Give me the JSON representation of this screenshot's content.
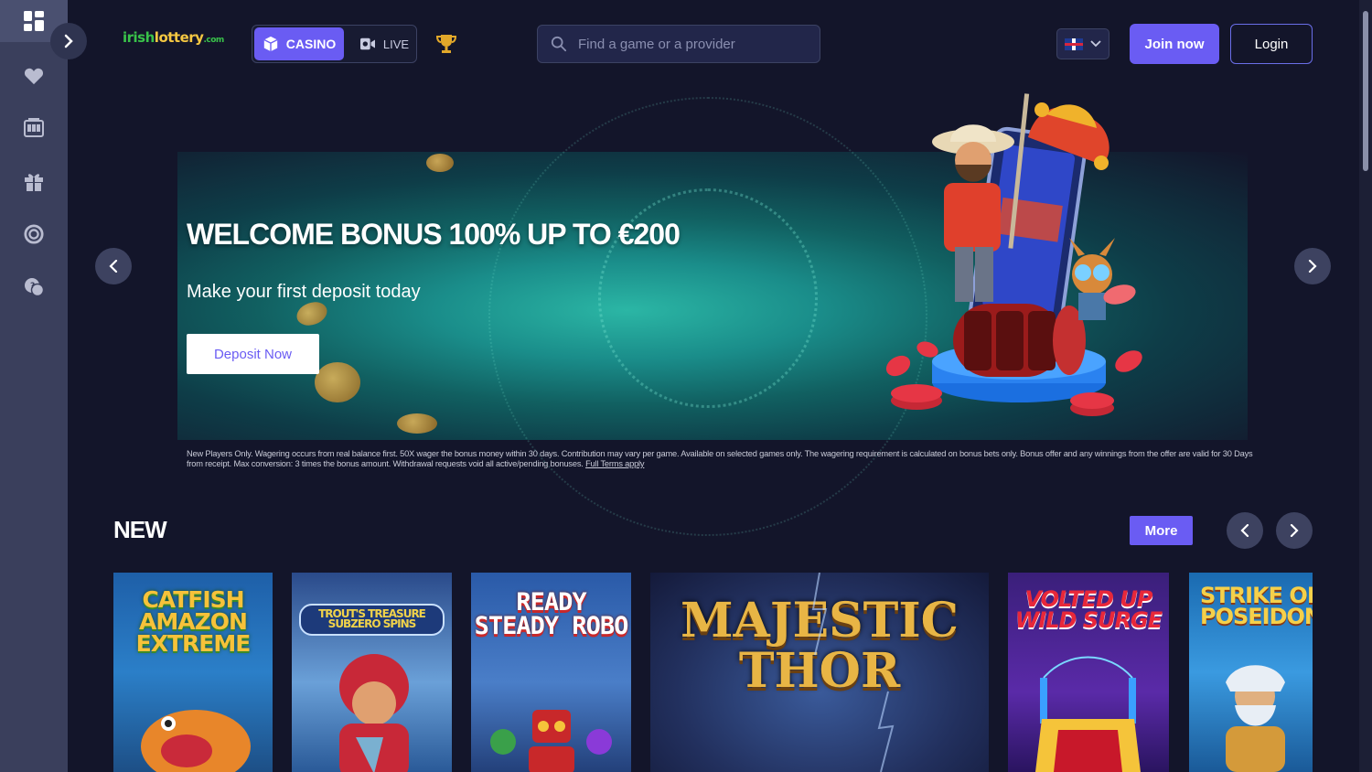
{
  "header": {
    "logo_text_green": "irish",
    "logo_text_gold": "lottery",
    "logo_suffix": ".com",
    "tabs": [
      {
        "label": "CASINO",
        "icon": "cube-icon",
        "active": true
      },
      {
        "label": "LIVE",
        "icon": "live-camera-icon",
        "active": false
      }
    ],
    "search": {
      "placeholder": "Find a game or a provider"
    },
    "language": "English (UK)",
    "join_label": "Join now",
    "login_label": "Login"
  },
  "sidebar": {
    "items": [
      {
        "name": "dashboard",
        "icon": "grid-icon"
      },
      {
        "name": "favorites",
        "icon": "heart-icon"
      },
      {
        "name": "casino",
        "icon": "casino-icon"
      },
      {
        "name": "promotions",
        "icon": "gift-icon"
      },
      {
        "name": "help",
        "icon": "lifebuoy-icon"
      },
      {
        "name": "support",
        "icon": "chat-icon"
      }
    ]
  },
  "banner": {
    "title": "WELCOME BONUS 100% UP TO €200",
    "subtitle": "Make your first deposit today",
    "cta_label": "Deposit Now",
    "terms": "New Players Only. Wagering occurs from real balance first. 50X wager the bonus money within 30 days. Contribution may vary per game. Available on selected games only. The wagering requirement is calculated on bonus bets only. Bonus offer and any winnings from the offer are valid for 30 Days from receipt. Max conversion: 3 times the bonus amount. Withdrawal requests void all active/pending bonuses.",
    "terms_link": "Full Terms apply"
  },
  "new_section": {
    "title": "NEW",
    "more_label": "More",
    "games": [
      {
        "title": "CATFISH AMAZON EXTREME"
      },
      {
        "title": "TROUT'S TREASURE SUBZERO SPINS"
      },
      {
        "title": "READY STEADY ROBO"
      },
      {
        "title": "MAJESTIC THOR"
      },
      {
        "title": "VOLTED UP WILD SURGE"
      },
      {
        "title": "STRIKE OF POSEIDON"
      }
    ]
  },
  "colors": {
    "accent": "#6a5cf3",
    "background": "#13152a",
    "sidebar": "#3a3f5c"
  }
}
